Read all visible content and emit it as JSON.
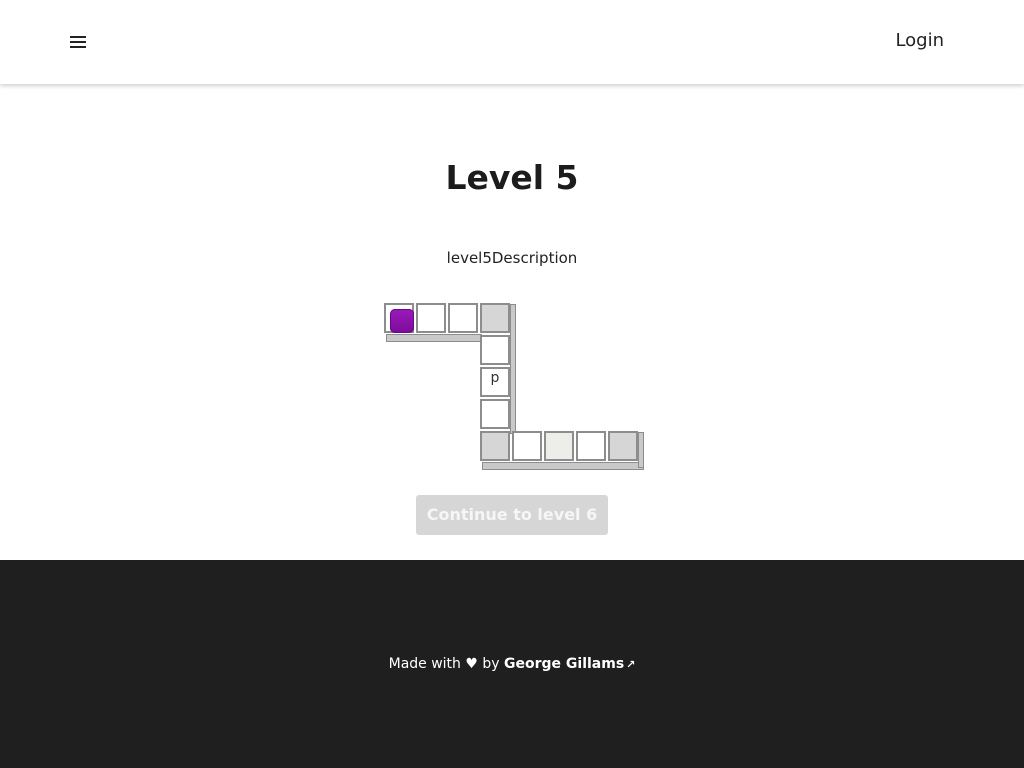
{
  "header": {
    "menu_icon": "hamburger-menu-icon",
    "login_label": "Login"
  },
  "main": {
    "title": "Level 5",
    "description": "level5Description",
    "continue_label": "Continue to level 6"
  },
  "board": {
    "cell_letter": "p",
    "player_color": "#8b14ab",
    "tile_colors": {
      "white": "#ffffff",
      "gray": "#d6d6d6",
      "light": "#ededea",
      "border": "#8d8d8d"
    }
  },
  "footer": {
    "made_with": "Made with ♥ by",
    "author": "George Gillams",
    "author_icon": "external-link-icon"
  }
}
